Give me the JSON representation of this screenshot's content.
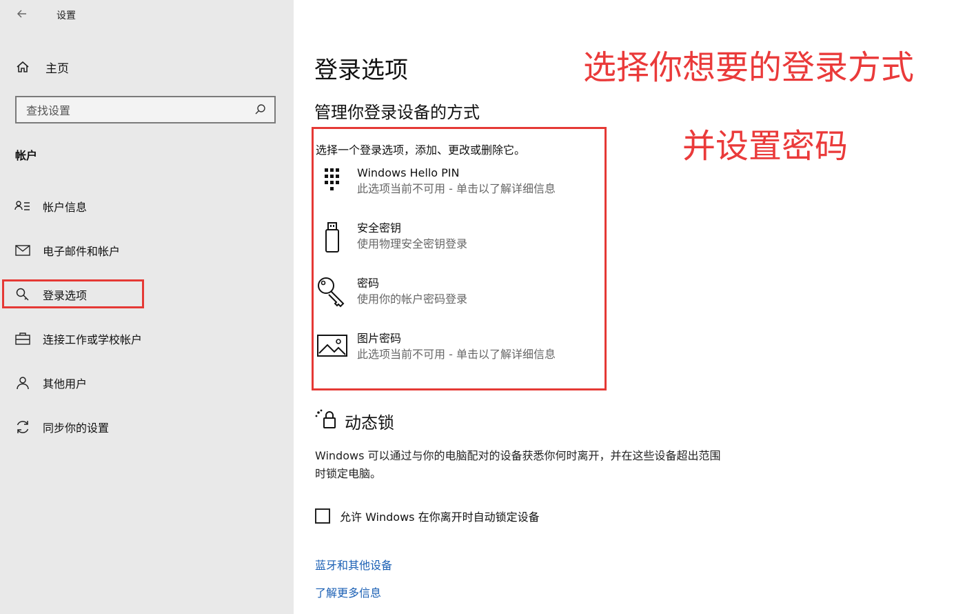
{
  "window": {
    "back_icon": "back-arrow-icon",
    "title": "设置"
  },
  "sidebar": {
    "home_label": "主页",
    "search_placeholder": "查找设置",
    "section": "帐户",
    "items": [
      {
        "label": "帐户信息",
        "icon": "account-info-icon"
      },
      {
        "label": "电子邮件和帐户",
        "icon": "mail-icon"
      },
      {
        "label": "登录选项",
        "icon": "key-icon",
        "selected": true
      },
      {
        "label": "连接工作或学校帐户",
        "icon": "briefcase-icon"
      },
      {
        "label": "其他用户",
        "icon": "person-icon"
      },
      {
        "label": "同步你的设置",
        "icon": "sync-icon"
      }
    ]
  },
  "main": {
    "title": "登录选项",
    "subtitle": "管理你登录设备的方式",
    "intro": "选择一个登录选项，添加、更改或删除它。",
    "options": [
      {
        "title": "Windows Hello PIN",
        "desc": "此选项当前不可用 - 单击以了解详细信息",
        "icon": "pin-keypad-icon"
      },
      {
        "title": "安全密钥",
        "desc": "使用物理安全密钥登录",
        "icon": "usb-key-icon"
      },
      {
        "title": "密码",
        "desc": "使用你的帐户密码登录",
        "icon": "key-icon"
      },
      {
        "title": "图片密码",
        "desc": "此选项当前不可用 - 单击以了解详细信息",
        "icon": "picture-icon"
      }
    ],
    "dynamic_lock": {
      "title": "动态锁",
      "desc": "Windows 可以通过与你的电脑配对的设备获悉你何时离开，并在这些设备超出范围时锁定电脑。",
      "checkbox_label": "允许 Windows 在你离开时自动锁定设备",
      "checked": false
    },
    "links": [
      "蓝牙和其他设备",
      "了解更多信息"
    ]
  },
  "annotations": {
    "line1": "选择你想要的登录方式",
    "line2": "并设置密码",
    "color": "#e53935"
  }
}
